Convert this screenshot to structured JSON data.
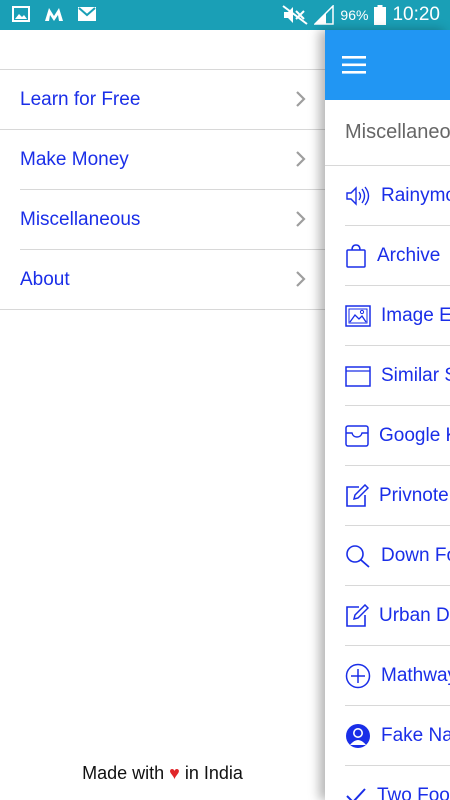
{
  "status_bar": {
    "battery_percent": "96%",
    "time": "10:20",
    "icons": [
      "gallery-icon",
      "m-app-icon",
      "mail-icon",
      "mute-icon",
      "signal-icon",
      "battery-icon"
    ]
  },
  "drawer": {
    "items": [
      {
        "label": "Learn for Free",
        "icon": "chevron-right-icon"
      },
      {
        "label": "Make Money",
        "icon": "chevron-right-icon"
      },
      {
        "label": "Miscellaneous",
        "icon": "chevron-right-icon"
      },
      {
        "label": "About",
        "icon": "chevron-right-icon"
      }
    ],
    "footer": {
      "prefix": "Made with ",
      "heart": "♥",
      "suffix": " in India"
    }
  },
  "main": {
    "section_title": "Miscellaneous",
    "items": [
      {
        "label": "Rainymood",
        "icon": "speaker-icon"
      },
      {
        "label": "Archive",
        "icon": "bag-icon"
      },
      {
        "label": "Image Editor",
        "icon": "image-icon"
      },
      {
        "label": "Similar Sites",
        "icon": "window-icon"
      },
      {
        "label": "Google Keep",
        "icon": "inbox-icon"
      },
      {
        "label": "Privnote",
        "icon": "edit-icon"
      },
      {
        "label": "Down For Everyone",
        "icon": "search-icon"
      },
      {
        "label": "Urban Dictionary",
        "icon": "edit-icon"
      },
      {
        "label": "Mathway",
        "icon": "plus-circle-icon"
      },
      {
        "label": "Fake Name Generator",
        "icon": "user-icon"
      },
      {
        "label": "Two Foods",
        "icon": "check-icon"
      }
    ]
  },
  "colors": {
    "status_bar": "#1a9fb6",
    "app_bar": "#2196f3",
    "link_blue": "#1a2ee8",
    "heart_red": "#e0262a"
  }
}
